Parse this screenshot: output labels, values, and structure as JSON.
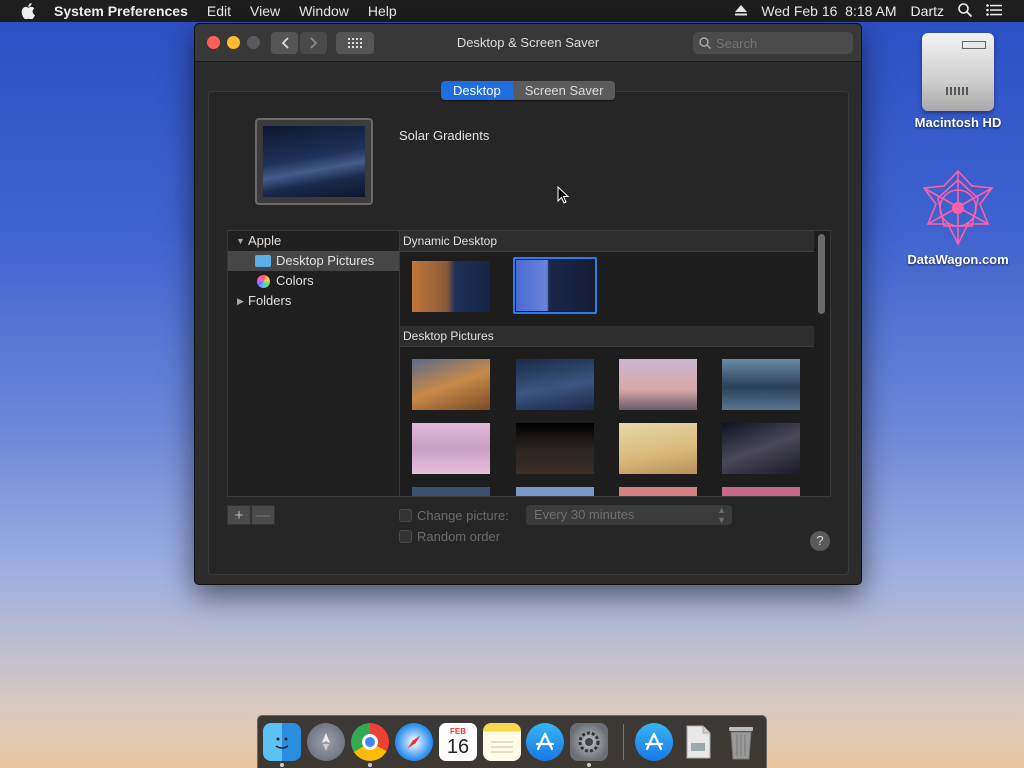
{
  "menubar": {
    "app_name": "System Preferences",
    "menus": [
      "Edit",
      "View",
      "Window",
      "Help"
    ],
    "clock": "Wed Feb 16  8:18 AM",
    "user": "Dartz"
  },
  "desktop": {
    "icons": [
      {
        "label": "Macintosh HD",
        "icon": "hard-drive-icon"
      },
      {
        "label": "DataWagon.com",
        "icon": "datawagon-logo-icon"
      }
    ]
  },
  "window": {
    "title": "Desktop & Screen Saver",
    "search_placeholder": "Search",
    "tabs": [
      {
        "label": "Desktop",
        "active": true
      },
      {
        "label": "Screen Saver",
        "active": false
      }
    ],
    "current_wallpaper": "Solar Gradients",
    "sources": {
      "apple": "Apple",
      "desktop_pictures": "Desktop Pictures",
      "colors": "Colors",
      "folders": "Folders"
    },
    "sections": {
      "dynamic": "Dynamic Desktop",
      "pictures": "Desktop Pictures"
    },
    "options": {
      "change_picture": "Change picture:",
      "interval": "Every 30 minutes",
      "random_order": "Random order"
    },
    "plus": "+",
    "minus": "—",
    "help": "?"
  },
  "dock": {
    "apps": [
      "Finder",
      "Launchpad",
      "Google Chrome",
      "Safari",
      "Calendar",
      "Notes",
      "App Store",
      "System Preferences",
      "App Store Downloads",
      "Documents",
      "Trash"
    ],
    "calendar_month": "FEB",
    "calendar_day": "16"
  },
  "colors": {
    "accent": "#1e6ee0",
    "close": "#fe5f57",
    "minimize": "#febc2e"
  }
}
